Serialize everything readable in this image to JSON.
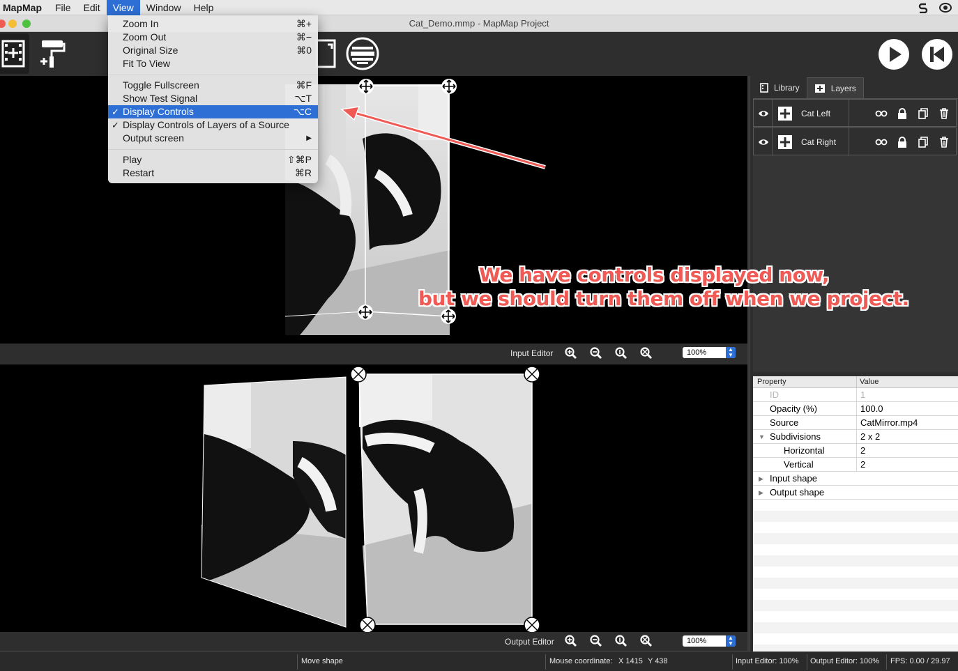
{
  "menubar": {
    "app_name": "MapMap",
    "items": [
      "File",
      "Edit",
      "View",
      "Window",
      "Help"
    ],
    "active": "View"
  },
  "window": {
    "title": "Cat_Demo.mmp - MapMap Project"
  },
  "view_menu": {
    "groups": [
      [
        {
          "label": "Zoom In",
          "shortcut": "⌘+"
        },
        {
          "label": "Zoom Out",
          "shortcut": "⌘−"
        },
        {
          "label": "Original Size",
          "shortcut": "⌘0"
        },
        {
          "label": "Fit To View",
          "shortcut": ""
        }
      ],
      [
        {
          "label": "Toggle Fullscreen",
          "shortcut": "⌘F"
        },
        {
          "label": "Show Test Signal",
          "shortcut": "⌥T"
        },
        {
          "label": "Display Controls",
          "shortcut": "⌥C",
          "checked": true,
          "highlighted": true
        },
        {
          "label": "Display Controls of Layers of a Source",
          "shortcut": "",
          "checked": true
        },
        {
          "label": "Output screen",
          "shortcut": "▶"
        }
      ],
      [
        {
          "label": "Play",
          "shortcut": "⇧⌘P"
        },
        {
          "label": "Restart",
          "shortcut": "⌘R"
        }
      ]
    ]
  },
  "input_editor": {
    "label": "Input Editor",
    "zoom": "100%"
  },
  "output_editor": {
    "label": "Output Editor",
    "zoom": "100%"
  },
  "right_panel": {
    "tabs": [
      {
        "label": "Library",
        "icon": "library-icon"
      },
      {
        "label": "Layers",
        "icon": "add-layer-icon",
        "selected": true
      }
    ],
    "layers": [
      {
        "name": "Cat Left"
      },
      {
        "name": "Cat Right"
      }
    ]
  },
  "properties": {
    "header_property": "Property",
    "header_value": "Value",
    "rows": [
      {
        "key": "ID",
        "value": "1",
        "disabled": true,
        "indent": 0
      },
      {
        "key": "Opacity (%)",
        "value": "100.0",
        "indent": 0
      },
      {
        "key": "Source",
        "value": "CatMirror.mp4",
        "indent": 0
      },
      {
        "key": "Subdivisions",
        "value": "2 x 2",
        "indent": 0,
        "expander": "expanded"
      },
      {
        "key": "Horizontal",
        "value": "2",
        "indent": 1
      },
      {
        "key": "Vertical",
        "value": "2",
        "indent": 1
      },
      {
        "key": "Input shape",
        "value": "",
        "indent": 0,
        "expander": "collapsed"
      },
      {
        "key": "Output shape",
        "value": "",
        "indent": 0,
        "expander": "collapsed"
      }
    ]
  },
  "status": {
    "action": "Move shape",
    "mouse_label": "Mouse coordinate:",
    "mouse_x": "X 1415",
    "mouse_y": "Y 438",
    "input_zoom": "Input Editor: 100%",
    "output_zoom": "Output Editor: 100%",
    "fps": "FPS: 0.00 / 29.97"
  },
  "annotation": {
    "line1": "We have controls displayed now,",
    "line2": "but we should turn them off when we project."
  },
  "colors": {
    "accent": "#2e6fd6",
    "annotation": "#f05a55",
    "panel": "#2e2e2e"
  }
}
